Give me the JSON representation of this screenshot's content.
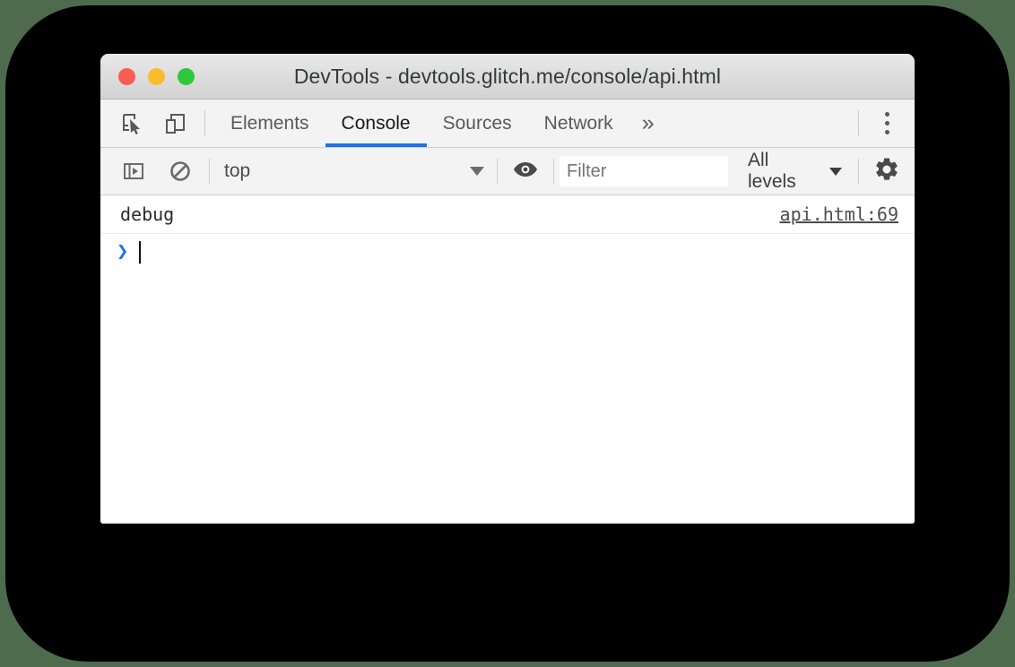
{
  "window": {
    "title": "DevTools - devtools.glitch.me/console/api.html",
    "traffic_lights": [
      {
        "name": "close",
        "color": "#fc5c54"
      },
      {
        "name": "minimize",
        "color": "#fcbb2f"
      },
      {
        "name": "zoom",
        "color": "#2fc83d"
      }
    ]
  },
  "tabstrip": {
    "icons": [
      {
        "name": "inspect-element-icon"
      },
      {
        "name": "device-toolbar-icon"
      }
    ],
    "tabs": [
      {
        "label": "Elements",
        "active": false
      },
      {
        "label": "Console",
        "active": true
      },
      {
        "label": "Sources",
        "active": false
      },
      {
        "label": "Network",
        "active": false
      }
    ],
    "overflow_label": "»",
    "more_menu": "more-options-icon",
    "active_tab_color": "#1a73e8"
  },
  "console_toolbar": {
    "sidebar_toggle": "show-console-sidebar-icon",
    "clear_console": "clear-console-icon",
    "context": {
      "value": "top"
    },
    "live_expression": "eye-icon",
    "filter": {
      "value": "",
      "placeholder": "Filter"
    },
    "levels": {
      "value": "All levels"
    },
    "settings": "gear-icon"
  },
  "console": {
    "messages": [
      {
        "text": "debug",
        "source": "api.html:69"
      }
    ],
    "prompt": {
      "arrow": "›",
      "value": ""
    }
  },
  "colors": {
    "page_background": "#4e6b4e",
    "backdrop": "#000000",
    "accent": "#1a73e8",
    "toolbar": "#f3f3f3"
  }
}
